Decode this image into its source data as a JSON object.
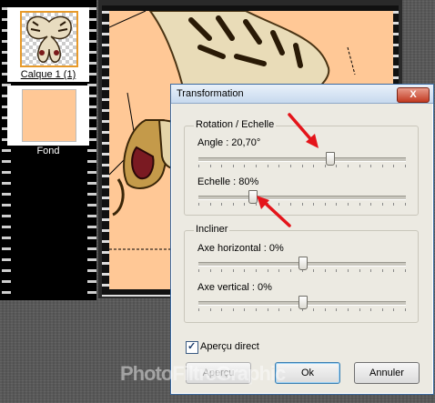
{
  "layers": {
    "items": [
      {
        "label": "Calque 1 (1)"
      },
      {
        "label": "Fond"
      }
    ]
  },
  "dialog": {
    "title": "Transformation",
    "close_label": "X",
    "rotation_group": {
      "title": "Rotation / Echelle",
      "angle_label": "Angle : 20,70°",
      "angle_value": 0.63,
      "scale_label": "Echelle : 80%",
      "scale_value": 0.26
    },
    "incline_group": {
      "title": "Incliner",
      "horizontal_label": "Axe horizontal : 0%",
      "horizontal_value": 0.5,
      "vertical_label": "Axe vertical : 0%",
      "vertical_value": 0.5
    },
    "preview_checkbox": {
      "label": "Aperçu direct",
      "checked": true
    },
    "buttons": {
      "preview": "Aperçu",
      "ok": "Ok",
      "cancel": "Annuler"
    }
  },
  "watermark": "PhotoFiltreGraphic",
  "colors": {
    "canvas_bg": "#ffc896",
    "arrow": "#e4141a",
    "dialog_bg": "#eceae2"
  }
}
